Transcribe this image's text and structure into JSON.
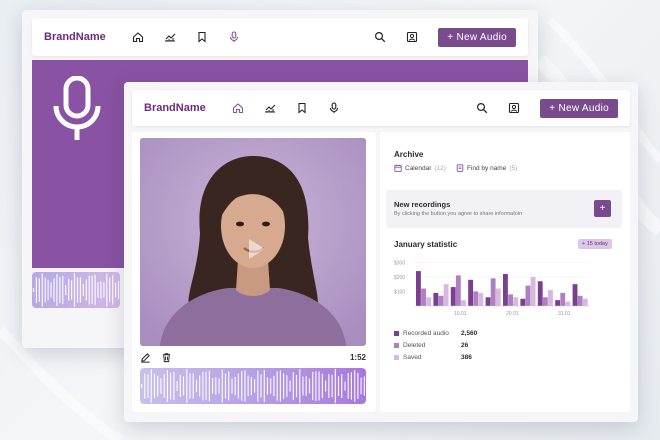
{
  "brand": "BrandName",
  "new_audio_label": "+ New Audio",
  "icons": {
    "nav": [
      "home-icon",
      "chart-line-icon",
      "bookmark-icon",
      "microphone-icon"
    ],
    "right": [
      "search-icon",
      "profile-card-icon"
    ]
  },
  "player": {
    "duration": "1:52"
  },
  "archive": {
    "title": "Archive",
    "items": [
      {
        "label": "Calendar",
        "count": "(12)"
      },
      {
        "label": "Find by name",
        "count": "(5)"
      }
    ]
  },
  "new_recordings": {
    "title": "New recordings",
    "subtitle": "By clicking the button you agree to share informatoin",
    "button_label": "+"
  },
  "statistic": {
    "title": "January statistic",
    "badge": "+ 15 today",
    "legend": [
      {
        "label": "Recorded audio",
        "value": "2,560",
        "color": "#7a3f8f"
      },
      {
        "label": "Deleted",
        "value": "26",
        "color": "#b07fc2"
      },
      {
        "label": "Saved",
        "value": "386",
        "color": "#d6b9e0"
      }
    ]
  },
  "chart_data": {
    "type": "bar",
    "title": "January statistic",
    "yticks": [
      "$300",
      "$200",
      "$100"
    ],
    "ytick_values": [
      300,
      200,
      100
    ],
    "ylim": [
      0,
      330
    ],
    "xticks": [
      "10.01",
      "20.01",
      "31.01"
    ],
    "series": [
      {
        "name": "Recorded audio",
        "color": "#7a3f8f",
        "values": [
          240,
          90,
          130,
          180,
          60,
          220,
          50,
          170,
          40,
          150
        ]
      },
      {
        "name": "Deleted",
        "color": "#b07fc2",
        "values": [
          120,
          70,
          210,
          100,
          190,
          80,
          140,
          60,
          90,
          70
        ]
      },
      {
        "name": "Saved",
        "color": "#d6b9e0",
        "values": [
          60,
          150,
          40,
          90,
          120,
          60,
          200,
          110,
          30,
          50
        ]
      }
    ]
  },
  "colors": {
    "accent": "#7a4a8f",
    "brand": "#6e2c7f",
    "hero": "#8a52a2"
  }
}
